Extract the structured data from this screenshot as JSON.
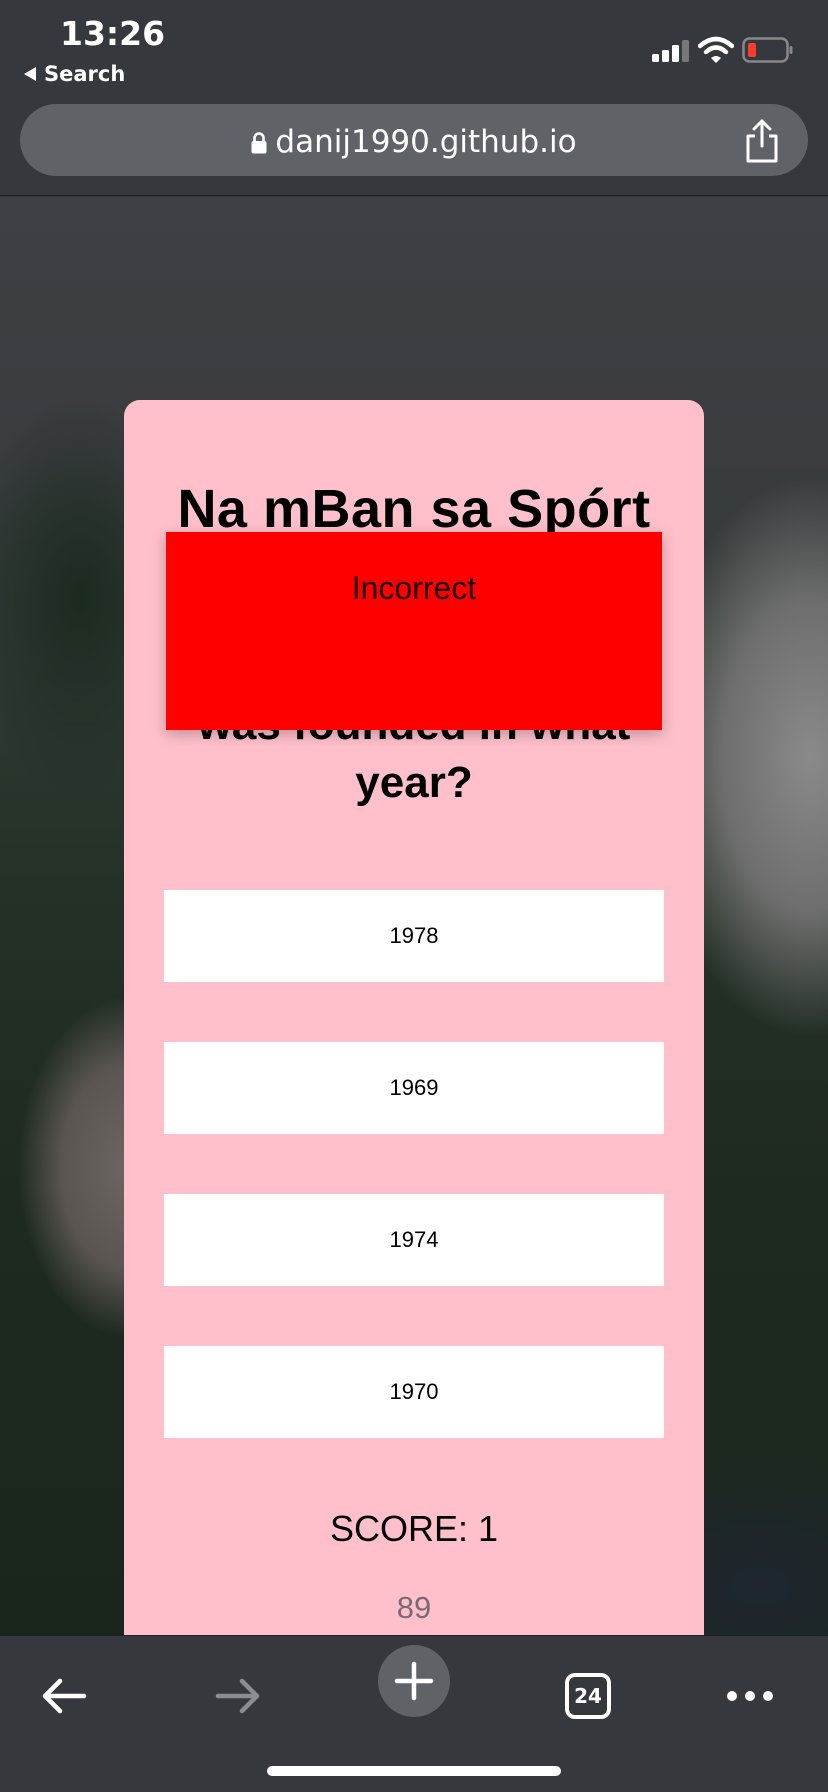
{
  "status_bar": {
    "time": "13:26",
    "back_app_label": "Search"
  },
  "url_bar": {
    "url": "danij1990.github.io"
  },
  "quiz": {
    "title": "Na mBan sa Spórt",
    "question_visible": "was founded in what year?",
    "answers": [
      "1978",
      "1969",
      "1974",
      "1970"
    ],
    "score": "SCORE: 1",
    "timer": "89",
    "feedback": "Incorrect",
    "colors": {
      "card": "#ffc0cb",
      "feedback": "#ff0000",
      "answer_bg": "#ffffff"
    }
  },
  "toolbar": {
    "tab_count": "24",
    "icons": [
      "back-arrow-icon",
      "forward-arrow-icon",
      "plus-icon",
      "tabs-icon",
      "more-icon"
    ]
  }
}
